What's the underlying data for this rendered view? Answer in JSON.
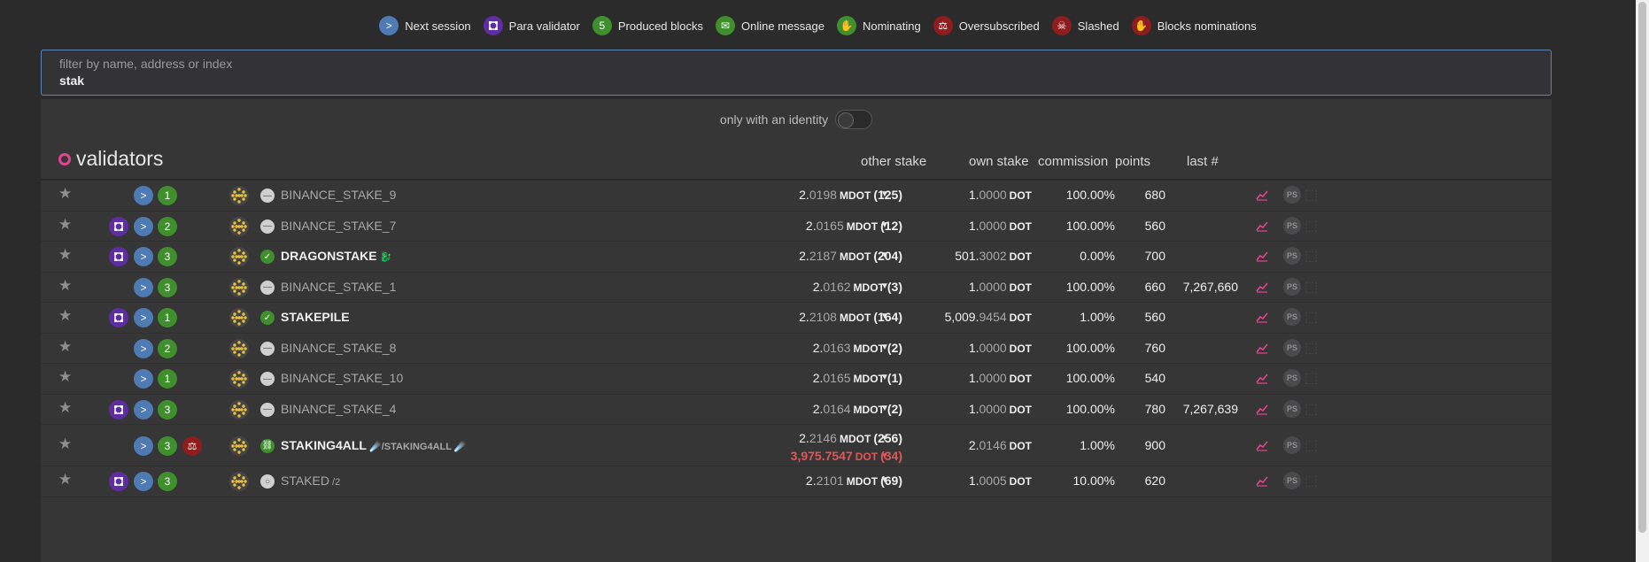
{
  "legend": [
    {
      "icon": "chevron-right-icon",
      "badge": ">",
      "color": "#4f7bb5",
      "label": "Next session"
    },
    {
      "icon": "para-validator-icon",
      "badge": "",
      "color": "#5e2da3",
      "label": "Para validator"
    },
    {
      "icon": "produced-blocks-badge",
      "badge": "5",
      "color": "#3f8f2d",
      "label": "Produced blocks"
    },
    {
      "icon": "envelope-icon",
      "badge": "✉",
      "color": "#3f8f2d",
      "label": "Online message"
    },
    {
      "icon": "hand-icon",
      "badge": "✋",
      "color": "#3f8f2d",
      "label": "Nominating"
    },
    {
      "icon": "oversubscribed-icon",
      "badge": "⚖",
      "color": "#8f1d1d",
      "label": "Oversubscribed"
    },
    {
      "icon": "skull-icon",
      "badge": "☠",
      "color": "#8f1d1d",
      "label": "Slashed"
    },
    {
      "icon": "blocks-nominations-icon",
      "badge": "✋",
      "color": "#8f1d1d",
      "label": "Blocks nominations"
    }
  ],
  "filter": {
    "placeholder": "filter by name, address or index",
    "value": "stak"
  },
  "identity_toggle": {
    "label": "only with an identity",
    "on": false
  },
  "table": {
    "title": "validators",
    "columns": {
      "other_stake": "other stake",
      "own_stake": "own stake",
      "commission": "commission",
      "points": "points",
      "last": "last #"
    },
    "rows": [
      {
        "para": false,
        "produced": "1",
        "oversub": false,
        "status": "none",
        "name": "BINANCE_STAKE_9",
        "named_bold": false,
        "extra": "",
        "other": {
          "int": "2.",
          "dec": "0198",
          "unit": "MDOT",
          "count": "(125)"
        },
        "other2": null,
        "own": {
          "int": "1.",
          "dec": "0000",
          "unit": "DOT"
        },
        "commission": "100.00%",
        "points": "680",
        "last": ""
      },
      {
        "para": true,
        "produced": "2",
        "oversub": false,
        "status": "none",
        "name": "BINANCE_STAKE_7",
        "named_bold": false,
        "extra": "",
        "other": {
          "int": "2.",
          "dec": "0165",
          "unit": "MDOT",
          "count": "(12)"
        },
        "other2": null,
        "own": {
          "int": "1.",
          "dec": "0000",
          "unit": "DOT"
        },
        "commission": "100.00%",
        "points": "560",
        "last": ""
      },
      {
        "para": true,
        "produced": "3",
        "oversub": false,
        "status": "ok",
        "name": "DRAGONSTAKE",
        "named_bold": true,
        "extra": "🐉",
        "other": {
          "int": "2.",
          "dec": "2187",
          "unit": "MDOT",
          "count": "(204)"
        },
        "other2": null,
        "own": {
          "int": "501.",
          "dec": "3002",
          "unit": "DOT"
        },
        "commission": "0.00%",
        "points": "700",
        "last": ""
      },
      {
        "para": false,
        "produced": "3",
        "oversub": false,
        "status": "none",
        "name": "BINANCE_STAKE_1",
        "named_bold": false,
        "extra": "",
        "other": {
          "int": "2.",
          "dec": "0162",
          "unit": "MDOT",
          "count": "(3)"
        },
        "other2": null,
        "own": {
          "int": "1.",
          "dec": "0000",
          "unit": "DOT"
        },
        "commission": "100.00%",
        "points": "660",
        "last": "7,267,660"
      },
      {
        "para": true,
        "produced": "1",
        "oversub": false,
        "status": "ok",
        "name": "STAKEPILE",
        "named_bold": true,
        "extra": "",
        "other": {
          "int": "2.",
          "dec": "2108",
          "unit": "MDOT",
          "count": "(164)"
        },
        "other2": null,
        "own": {
          "int": "5,009.",
          "dec": "9454",
          "unit": "DOT"
        },
        "commission": "1.00%",
        "points": "560",
        "last": ""
      },
      {
        "para": false,
        "produced": "2",
        "oversub": false,
        "status": "none",
        "name": "BINANCE_STAKE_8",
        "named_bold": false,
        "extra": "",
        "other": {
          "int": "2.",
          "dec": "0163",
          "unit": "MDOT",
          "count": "(2)"
        },
        "other2": null,
        "own": {
          "int": "1.",
          "dec": "0000",
          "unit": "DOT"
        },
        "commission": "100.00%",
        "points": "760",
        "last": ""
      },
      {
        "para": false,
        "produced": "1",
        "oversub": false,
        "status": "none",
        "name": "BINANCE_STAKE_10",
        "named_bold": false,
        "extra": "",
        "other": {
          "int": "2.",
          "dec": "0165",
          "unit": "MDOT",
          "count": "(1)"
        },
        "other2": null,
        "own": {
          "int": "1.",
          "dec": "0000",
          "unit": "DOT"
        },
        "commission": "100.00%",
        "points": "540",
        "last": ""
      },
      {
        "para": true,
        "produced": "3",
        "oversub": false,
        "status": "none",
        "name": "BINANCE_STAKE_4",
        "named_bold": false,
        "extra": "",
        "other": {
          "int": "2.",
          "dec": "0164",
          "unit": "MDOT",
          "count": "(2)"
        },
        "other2": null,
        "own": {
          "int": "1.",
          "dec": "0000",
          "unit": "DOT"
        },
        "commission": "100.00%",
        "points": "780",
        "last": "7,267,639"
      },
      {
        "para": false,
        "produced": "3",
        "oversub": true,
        "status": "link",
        "name": "STAKING4ALL",
        "named_bold": true,
        "extra": "☄️/STAKING4ALL ☄️",
        "other": {
          "int": "2.",
          "dec": "2146",
          "unit": "MDOT",
          "count": "(256)"
        },
        "other2": {
          "int": "3,975.",
          "dec": "7547",
          "unit": "DOT",
          "count": "(34)"
        },
        "own": {
          "int": "2.",
          "dec": "0146",
          "unit": "DOT"
        },
        "commission": "1.00%",
        "points": "900",
        "last": ""
      },
      {
        "para": true,
        "produced": "3",
        "oversub": false,
        "status": "ring",
        "name": "STAKED",
        "named_bold": false,
        "extra": "/2",
        "other": {
          "int": "2.",
          "dec": "2101",
          "unit": "MDOT",
          "count": "(69)"
        },
        "other2": null,
        "own": {
          "int": "1.",
          "dec": "0005",
          "unit": "DOT"
        },
        "commission": "10.00%",
        "points": "620",
        "last": ""
      }
    ]
  },
  "colors": {
    "accent": "#e3468f",
    "next_session": "#4f7bb5",
    "para": "#5e2da3",
    "produced": "#3f8f2d",
    "danger": "#e45656"
  }
}
